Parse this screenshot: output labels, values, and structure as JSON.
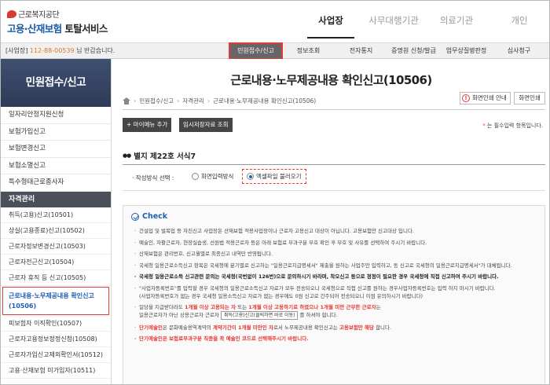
{
  "header": {
    "org_name": "근로복지공단",
    "service_name_blue": "고용·산재보험",
    "service_name_dark": "토탈서비스",
    "top_nav": [
      "사업장",
      "사무대행기관",
      "의료기관",
      "개인"
    ],
    "top_nav_active": "사업장"
  },
  "subbar": {
    "workplace_prefix": "[사업장]",
    "workplace_number": "112-88-00539",
    "workplace_suffix": "님 반갑습니다.",
    "menu": [
      "민원접수/신고",
      "정보조회",
      "전자통지",
      "증명원 신청/발급",
      "업무상질병판정",
      "심사청구"
    ],
    "menu_active": "민원접수/신고"
  },
  "sidebar": {
    "title": "민원접수/신고",
    "items": [
      "일자리안정지원신청",
      "보험가입신고",
      "보험변경신고",
      "보험소멸신고",
      "특수형태근로종사자"
    ],
    "section_head": "자격관리",
    "sub_items": [
      "취득(고용)신고(10501)",
      "상실(고용종료)신고(10502)",
      "근로자정보변경신고(10503)",
      "근로자전근신고(10504)",
      "근로자 휴직 등 신고(10505)",
      "근로내용·노무제공내용 확인신고(10506)",
      "피보험자 이직확인(10507)",
      "근로자고용정보정정신청(10508)",
      "근로자가입신고제외확인서(10512)",
      "고용·산재보험 미가입자(10511)"
    ],
    "sub_active_index": 5
  },
  "main": {
    "title": "근로내용·노무제공내용 확인신고(10506)",
    "breadcrumb": [
      "민원접수/신고",
      "자격관리",
      "근로내용·노무제공내용 확인신고(10506)"
    ],
    "btn_print_guide": "화면인쇄 안내",
    "btn_print": "화면인쇄",
    "btn_add_menu": "+ 마이메뉴 추가",
    "btn_temp_save": "임시저장자료 조회",
    "required_note_star": "*",
    "required_note": "는 필수입력 항목입니다.",
    "section_title": "별지 제22호 서식7",
    "method_label": "· 작성방식 선택 :",
    "method_options": [
      "화면입력방식",
      "엑셀파일 불러오기"
    ],
    "method_selected": "엑셀파일 불러오기"
  },
  "check": {
    "title": "Check",
    "bullet_1": "건설업 및 벌목업 등 자진신고 사업장은 산재보험 적용사업장이나 근로자 고용신고 대상이 아닙니다. 고용보험만 신고대상 입니다.",
    "bullet_2": "예술인, 자활근로자, 현장실습생, 선원법 적용근로자 등은 아래 보험료 부과구분 부호 확인 후 부호 및 사유를 선택하여 주시기 바랍니다.",
    "bullet_3": "산재보험은 관리번호, 신고월별로 최종신고 내역만 반영됩니다.",
    "bullet_4": "국세청 일용근로소득신고 항목은 국세청에 분기별로 신고하는 \"일용근로지급명세서\" 제출을 원하는 사업주만 입력하고, 동 신고로 국세청의 일용근로지급명세서\"가 대체됩니다.",
    "bullet_5": "국세청 일용근로소득 신고관련 문의는 국세청(국번없이 126번)으로 문의하시기 바라며, 착오신고 등으로 정정이 필요한 경우 국세청에 직접 신고하여 주시기 바랍니다.",
    "bullet_6a": "\"사업자등록번호\"를 입력할 경우 국세청의 일용근로소득신고 자료가 모두 전송되오니 국세청으로 직접 신고를 원하는 경우사업자등록번호는 입력 하지 마시기 바랍니다.",
    "bullet_6b": "(사업자등록번호가 없는 경우 국세청 일용소득신고 자료가 없는 경우에도 0원 신고로 간주되어 전송되오니 이점 유의하시기 바랍니다)",
    "bullet_7_pre": "일당을 지급받더라도 ",
    "bullet_7_red1": "1개월 이상 고용되는 자",
    "bullet_7_mid": " 또는 ",
    "bullet_7_red2": "1개월 이상 고용하기로 하였으나 1개월 미만 근무한 근로자",
    "bullet_7_post": "는",
    "bullet_7_line2_pre": "일용근로자가 아닌 상용근로자 근로자",
    "bullet_7_btn": "취득(고용)신고(클릭하면 바로 이동)",
    "bullet_7_line2_post": "를 하셔야 합니다.",
    "bullet_8_red1": "단기예술인",
    "bullet_8_mid1": "은 문화예술용역계약의 ",
    "bullet_8_red2": "계약기간이 1개월 미만인 자",
    "bullet_8_mid2": "로서 노무제공내용 확인신고는 ",
    "bullet_8_red3": "고용보험만 해당",
    "bullet_8_end": " 합니다.",
    "bullet_9": "단기예술인은 보험료부과구분 직종을 꼭 예술인 코드로 선택해주시기 바랍니다."
  }
}
